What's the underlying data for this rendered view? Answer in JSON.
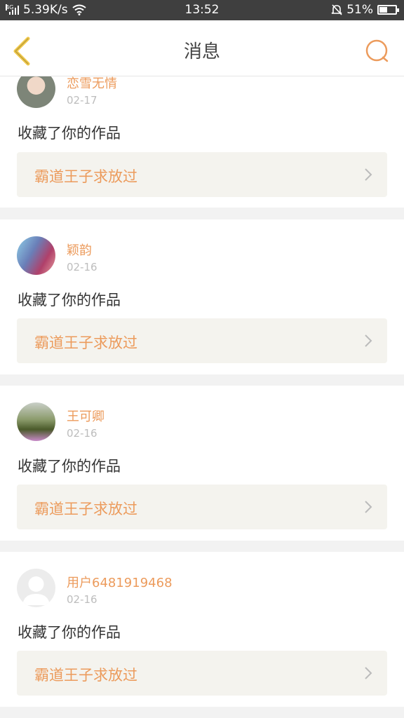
{
  "status_bar": {
    "network": "4G",
    "speed": "5.39K/s",
    "time": "13:52",
    "battery": "51%",
    "battery_level": 0.51
  },
  "header": {
    "title": "消息"
  },
  "colors": {
    "accent": "#ec9b5c",
    "muted": "#bdbdbd",
    "button_bg": "#f4f3ee"
  },
  "messages": [
    {
      "user": "恋雪无情",
      "date": "02-17",
      "action": "收藏了你的作品",
      "work": "霸道王子求放过"
    },
    {
      "user": "颖韵",
      "date": "02-16",
      "action": "收藏了你的作品",
      "work": "霸道王子求放过"
    },
    {
      "user": "王可卿",
      "date": "02-16",
      "action": "收藏了你的作品",
      "work": "霸道王子求放过"
    },
    {
      "user": "用户6481919468",
      "date": "02-16",
      "action": "收藏了你的作品",
      "work": "霸道王子求放过"
    }
  ]
}
